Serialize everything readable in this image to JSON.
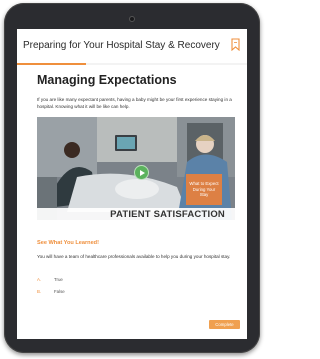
{
  "header": {
    "title": "Preparing for Your Hospital Stay & Recovery",
    "progress_percent": 30
  },
  "content": {
    "heading": "Managing Expectations",
    "intro": "If you are like many expectant parents, having a baby might be your first experience staying in a hospital. Knowing what it will be like can help."
  },
  "video": {
    "overlay_text": "What to Expect During Your Stay",
    "caption": "PATIENT SATISFACTION"
  },
  "quiz": {
    "title": "See What You Learned!",
    "question": "You will have a team of healthcare professionals available to help you during your hospital stay.",
    "options": [
      {
        "letter": "A.",
        "label": "True"
      },
      {
        "letter": "B.",
        "label": "False"
      }
    ]
  },
  "footer": {
    "complete_label": "Complete"
  },
  "colors": {
    "accent": "#ef8f3c",
    "play_button": "#5bb25d",
    "device_frame": "#2b2c30"
  }
}
